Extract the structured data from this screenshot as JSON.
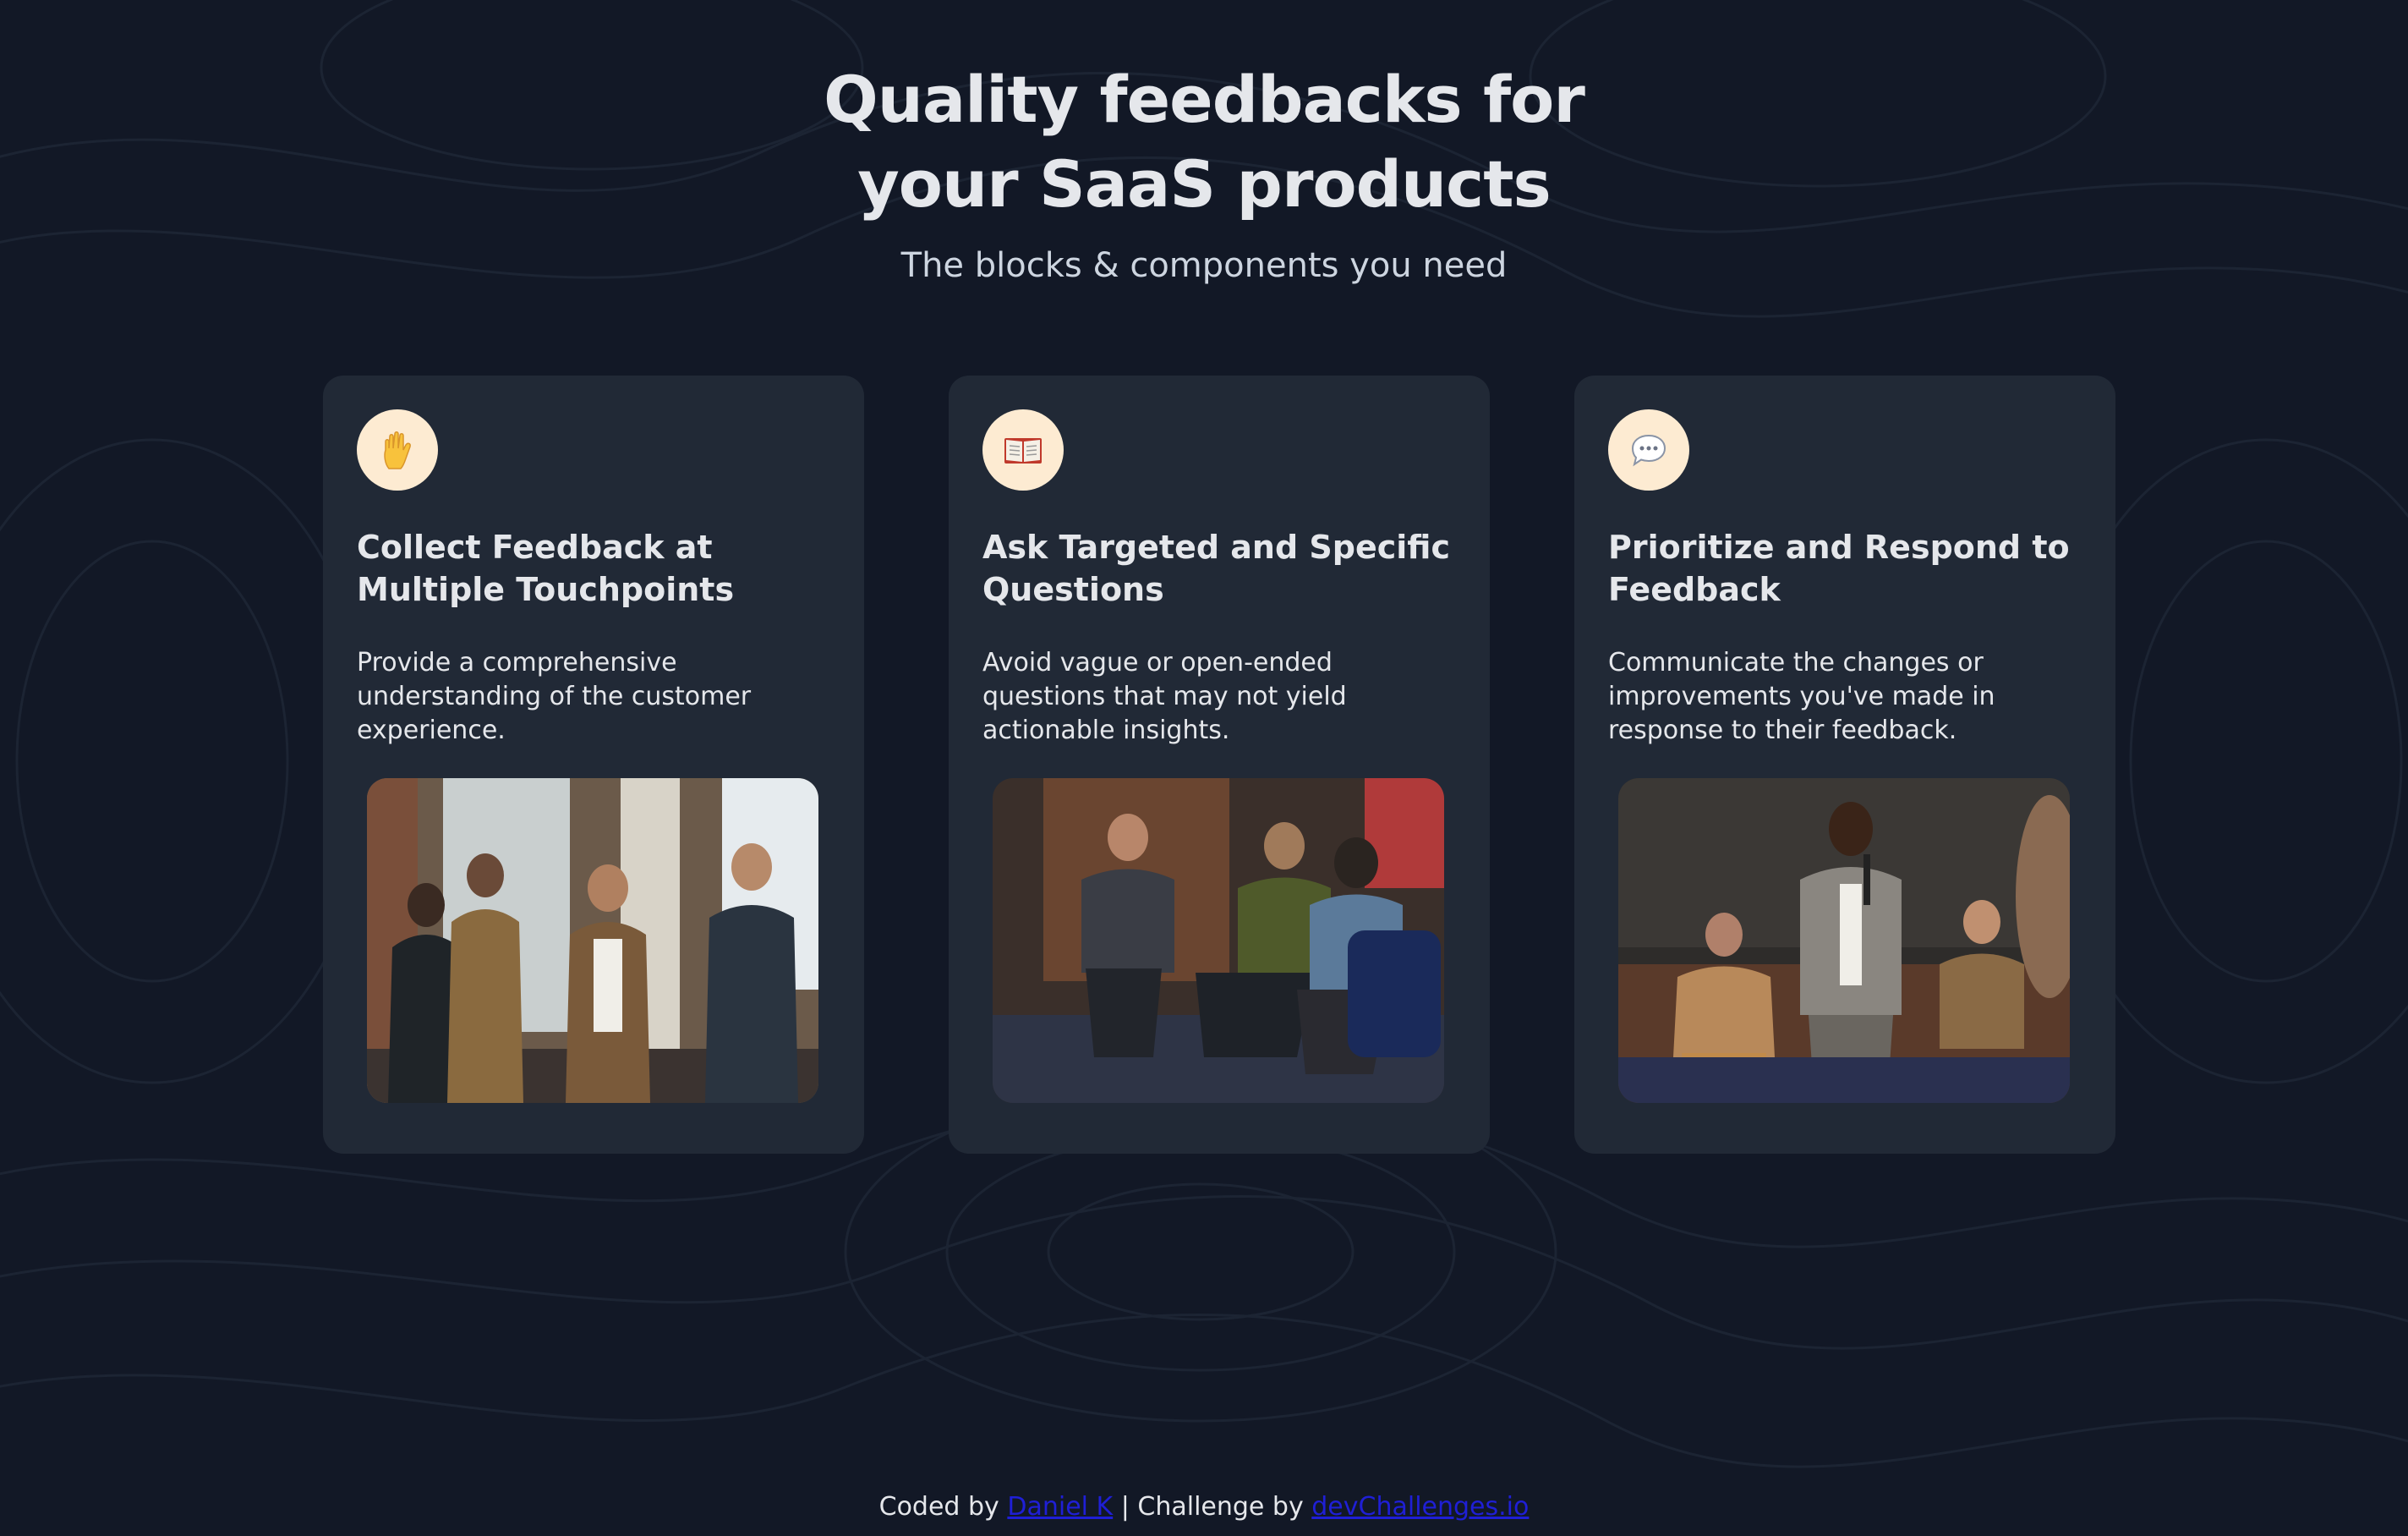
{
  "hero": {
    "title": "Quality feedbacks for your SaaS products",
    "subtitle": "The blocks & components you need"
  },
  "cards": [
    {
      "icon": "raised-hand-icon",
      "title": "Collect Feedback at Multiple Touchpoints",
      "description": "Provide a comprehensive understanding of the customer experience.",
      "image": "people standing and talking by a window"
    },
    {
      "icon": "open-book-icon",
      "title": "Ask Targeted and Specific Questions",
      "description": "Avoid vague or open-ended questions that may not yield actionable insights.",
      "image": "people seated in a discussion circle"
    },
    {
      "icon": "speech-bubble-icon",
      "title": "Prioritize and Respond to Feedback",
      "description": "Communicate the changes or improvements you've made in response to their feedback.",
      "image": "speaker with microphone on stage"
    }
  ],
  "footer": {
    "prefix": "Coded by",
    "author_link": "Daniel K",
    "middle": "| Challenge by",
    "challenge_link": "devChallenges.io"
  },
  "colors": {
    "background": "#121826",
    "card": "#212936",
    "icon_circle": "#fdebd2",
    "text": "#e5e7eb",
    "link": "#1f1fd6"
  }
}
